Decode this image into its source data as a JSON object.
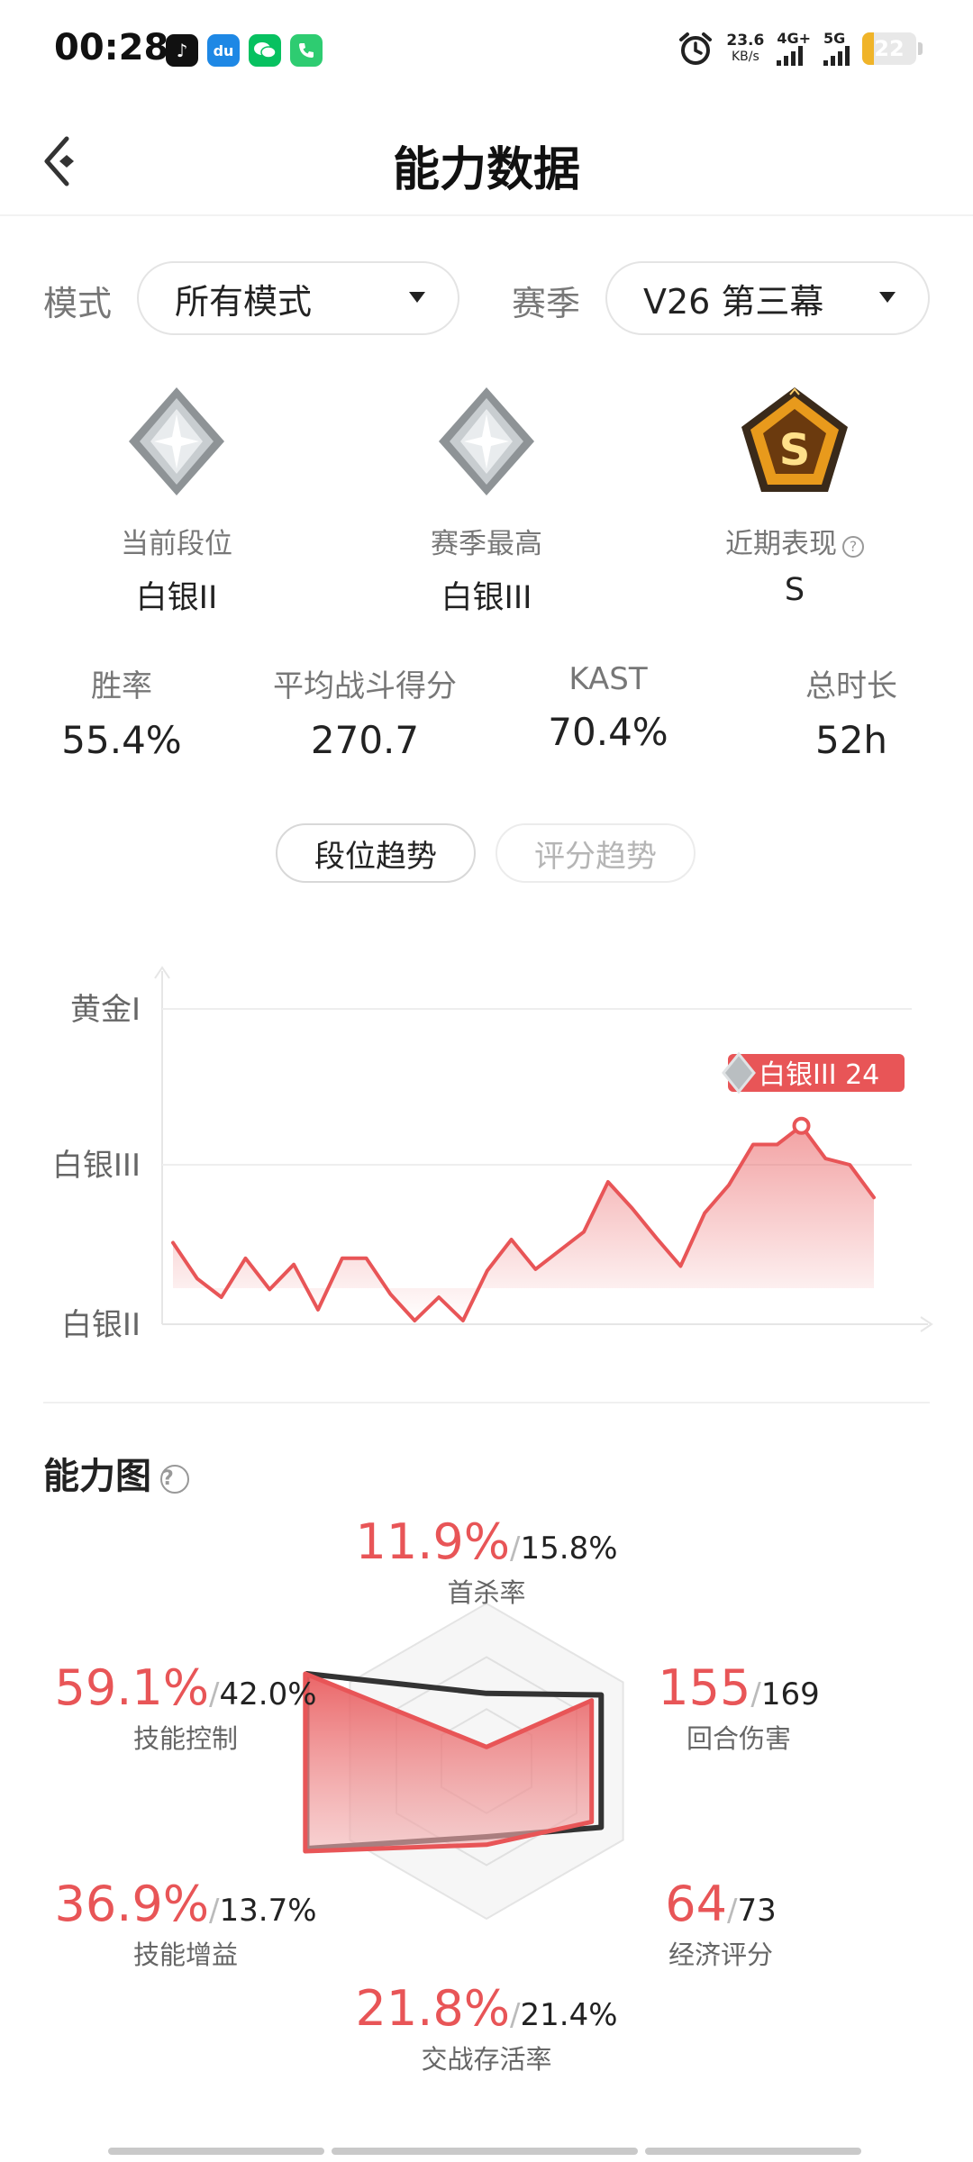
{
  "status_bar": {
    "time": "00:28",
    "app_icons": [
      "douyin-icon",
      "du-icon",
      "wechat-icon",
      "phone-icon"
    ],
    "net_speed_value": "23.6",
    "net_speed_unit": "KB/s",
    "signal_1": "4G+",
    "signal_2": "5G",
    "battery": "22",
    "battery_level": 0.22
  },
  "header": {
    "title": "能力数据"
  },
  "filters": {
    "mode_label": "模式",
    "mode_value": "所有模式",
    "season_label": "赛季",
    "season_value": "V26 第三幕"
  },
  "ranks": [
    {
      "label": "当前段位",
      "value": "白银II"
    },
    {
      "label": "赛季最高",
      "value": "白银III"
    },
    {
      "label": "近期表现",
      "value": "S",
      "badge_letter": "S"
    }
  ],
  "stats": [
    {
      "label": "胜率",
      "value": "55.4%"
    },
    {
      "label": "平均战斗得分",
      "value": "270.7"
    },
    {
      "label": "KAST",
      "value": "70.4%"
    },
    {
      "label": "总时长",
      "value": "52h"
    }
  ],
  "trend_tabs": [
    {
      "label": "段位趋势",
      "active": true
    },
    {
      "label": "评分趋势",
      "active": false
    }
  ],
  "chart_data": {
    "type": "area",
    "title": "",
    "xlabel": "",
    "ylabel": "",
    "y_tick_labels": [
      "白银II",
      "白银III",
      "黄金I"
    ],
    "ylim": [
      0,
      200
    ],
    "grid": true,
    "series": [
      {
        "color": "#e85557",
        "values": [
          50,
          27,
          15,
          40,
          20,
          36,
          7,
          40,
          40,
          17,
          0,
          15,
          0,
          32,
          52,
          33,
          45,
          57,
          89,
          72,
          53,
          35,
          69,
          87,
          113,
          113,
          125,
          104,
          100,
          79
        ]
      }
    ],
    "peak_label": "白银III 24",
    "peak_index": 26
  },
  "radar": {
    "title": "能力图",
    "colors": {
      "player": "#e85557",
      "average": "#333333"
    },
    "axes": [
      {
        "name": "首杀率",
        "player": "11.9%",
        "average": "15.8%",
        "player_r": 0.09,
        "avg_r": 0.43
      },
      {
        "name": "回合伤害",
        "player": "155",
        "average": "169",
        "player_r": 0.77,
        "avg_r": 0.84
      },
      {
        "name": "经济评分",
        "player": "64",
        "average": "73",
        "player_r": 0.77,
        "avg_r": 0.84
      },
      {
        "name": "交战存活率",
        "player": "21.8%",
        "average": "21.4%",
        "player_r": 0.53,
        "avg_r": 0.48
      },
      {
        "name": "技能增益",
        "player": "36.9%",
        "average": "13.7%",
        "player_r": 1.0,
        "avg_r": 1.0
      },
      {
        "name": "技能控制",
        "player": "59.1%",
        "average": "42.0%",
        "player_r": 1.0,
        "avg_r": 1.0
      }
    ]
  }
}
